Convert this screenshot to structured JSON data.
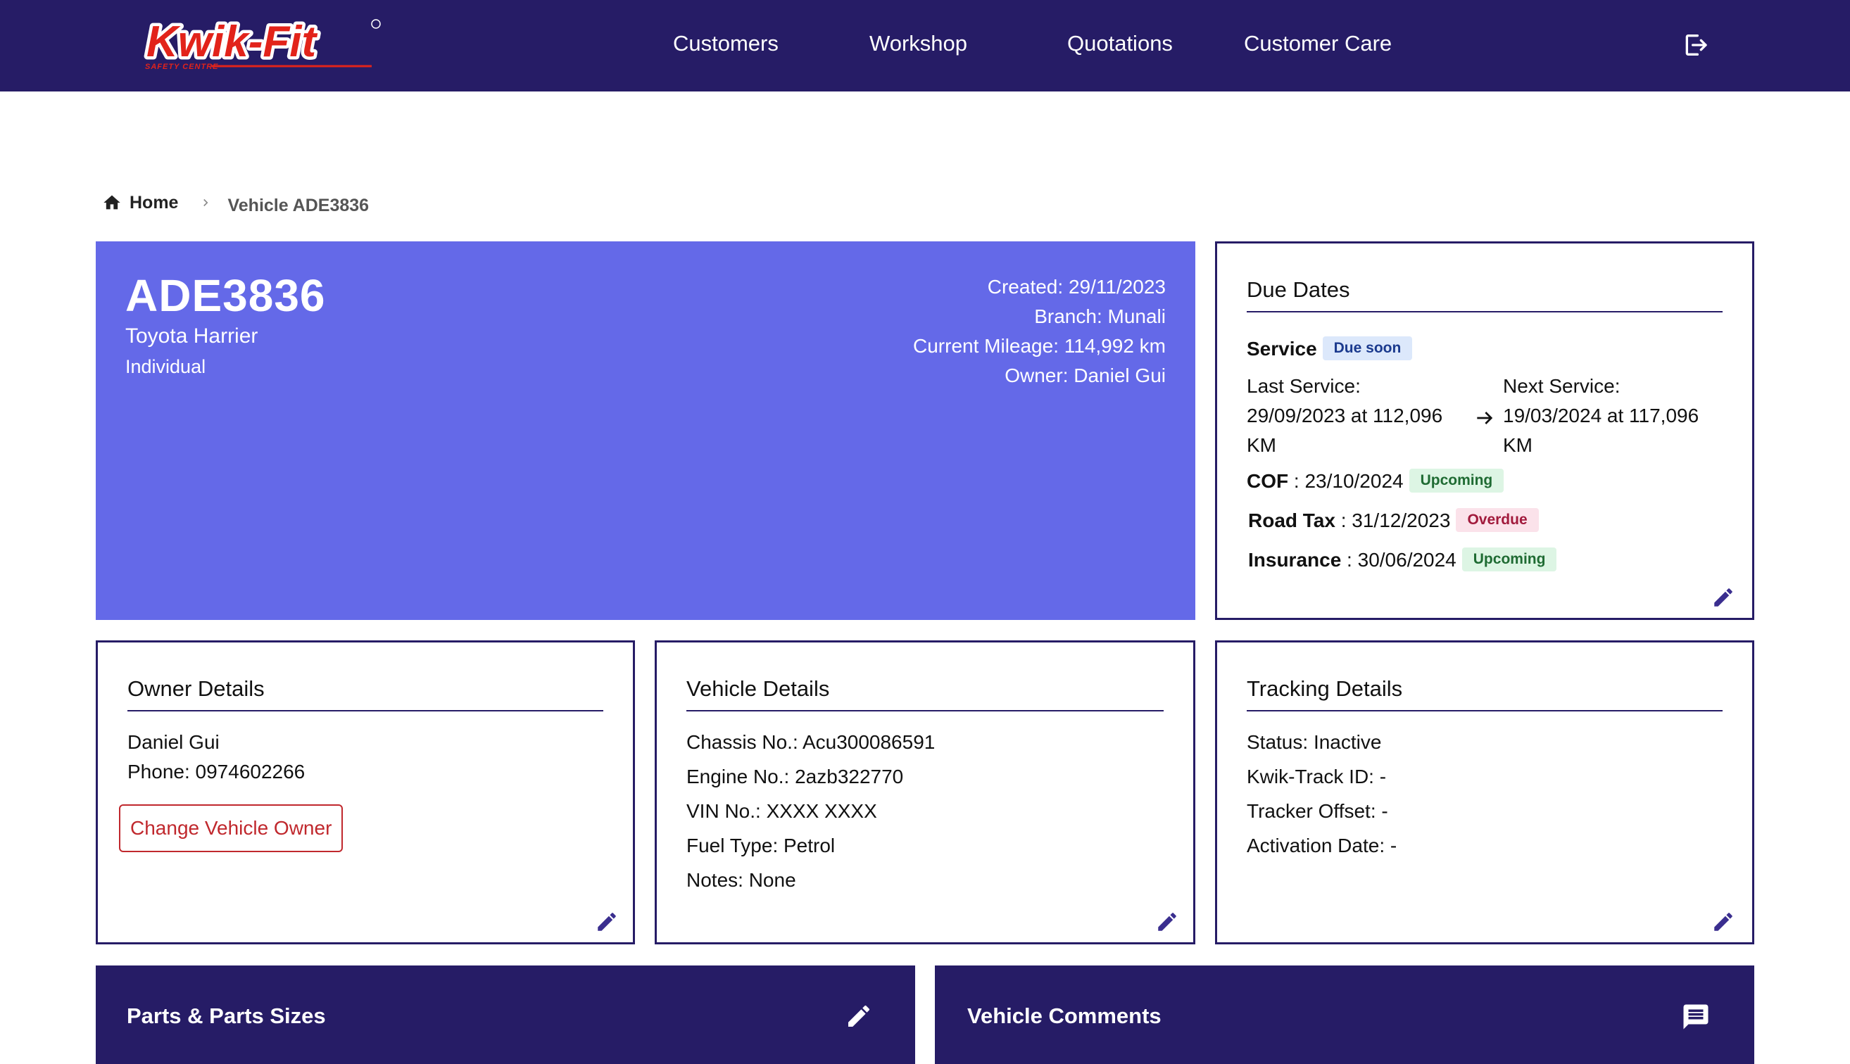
{
  "header": {
    "logo_text": "Kwik-Fit",
    "logo_subtext": "SAFETY CENTRE",
    "nav": [
      "Customers",
      "Workshop",
      "Quotations",
      "Customer Care"
    ]
  },
  "breadcrumb": {
    "home": "Home",
    "current": "Vehicle ADE3836"
  },
  "vehicle": {
    "plate": "ADE3836",
    "model": "Toyota Harrier",
    "type": "Individual",
    "created": "Created: 29/11/2023",
    "branch": "Branch: Munali",
    "mileage": "Current Mileage: 114,992 km",
    "owner": "Owner: Daniel Gui"
  },
  "due_dates": {
    "title": "Due Dates",
    "service_label": "Service",
    "service_badge": "Due soon",
    "last_service_label": "Last Service:",
    "last_service_value": "29/09/2023 at 112,096",
    "last_service_unit": "KM",
    "next_service_label": "Next Service:",
    "next_service_value": "19/03/2024 at 117,096",
    "next_service_unit": "KM",
    "cof_label": "COF",
    "cof_value": " : 23/10/2024",
    "cof_badge": "Upcoming",
    "roadtax_label": "Road Tax",
    "roadtax_value": " : 31/12/2023",
    "roadtax_badge": "Overdue",
    "insurance_label": "Insurance",
    "insurance_value": " : 30/06/2024",
    "insurance_badge": "Upcoming"
  },
  "owner_details": {
    "title": "Owner Details",
    "name": "Daniel Gui",
    "phone": "Phone: 0974602266",
    "change_button": "Change Vehicle Owner"
  },
  "vehicle_details": {
    "title": "Vehicle Details",
    "chassis": "Chassis No.: Acu300086591",
    "engine": "Engine No.: 2azb322770",
    "vin": "VIN No.: XXXX XXXX",
    "fuel": "Fuel Type: Petrol",
    "notes": "Notes: None"
  },
  "tracking_details": {
    "title": "Tracking Details",
    "status": "Status: Inactive",
    "kwik_track": "Kwik-Track ID: -",
    "offset": "Tracker Offset: -",
    "activation": "Activation Date: -"
  },
  "panels": {
    "parts": "Parts & Parts Sizes",
    "comments": "Vehicle Comments"
  },
  "colors": {
    "navy": "#261c66",
    "hero": "#6469e8",
    "brand_red": "#e2231a"
  }
}
